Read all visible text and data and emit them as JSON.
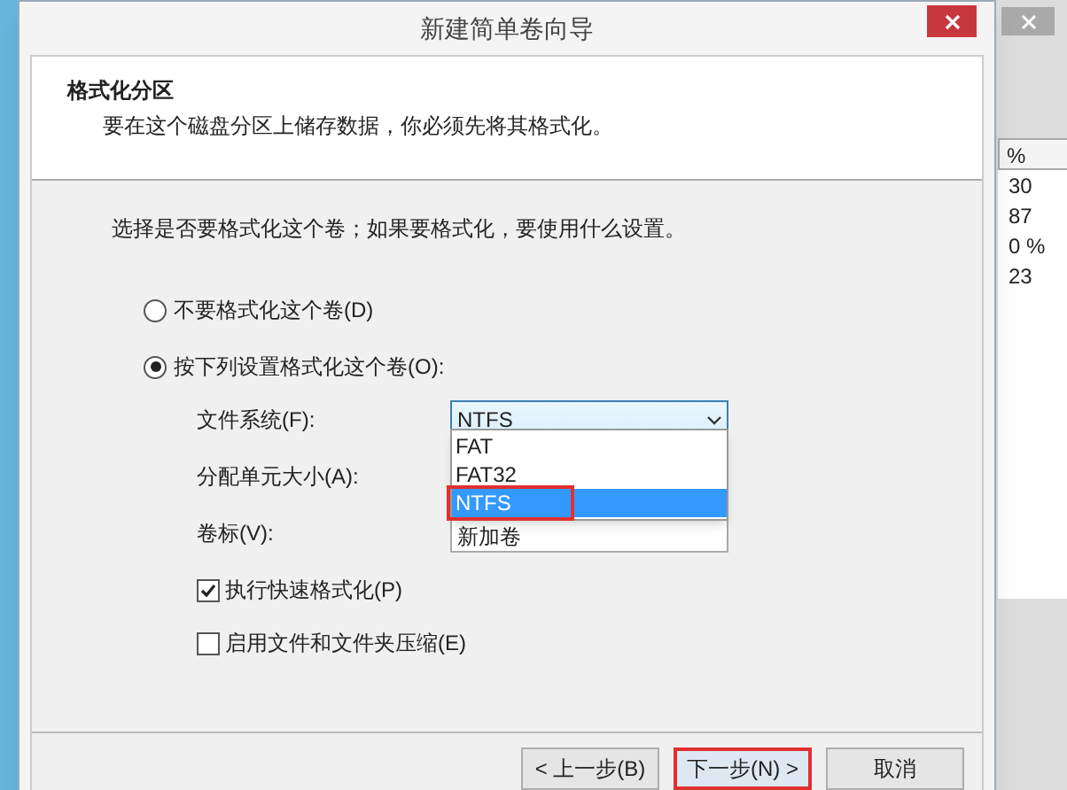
{
  "window": {
    "title": "新建简单卷向导"
  },
  "header": {
    "title": "格式化分区",
    "subtitle": "要在这个磁盘分区上储存数据，你必须先将其格式化。"
  },
  "instruction": "选择是否要格式化这个卷；如果要格式化，要使用什么设置。",
  "options": [
    {
      "label": "不要格式化这个卷(D)",
      "selected": false
    },
    {
      "label": "按下列设置格式化这个卷(O):",
      "selected": true
    }
  ],
  "fields": [
    {
      "label": "文件系统(F):",
      "kind": "combo",
      "value": "NTFS"
    },
    {
      "label": "分配单元大小(A):",
      "kind": "hidden"
    },
    {
      "label": "卷标(V):",
      "kind": "text",
      "value": "新加卷"
    }
  ],
  "dropdown": {
    "items": [
      {
        "label": "FAT",
        "selected": false
      },
      {
        "label": "FAT32",
        "selected": false
      },
      {
        "label": "NTFS",
        "selected": true
      }
    ]
  },
  "checkboxes": [
    {
      "label": "执行快速格式化(P)",
      "checked": true
    },
    {
      "label": "启用文件和文件夹压缩(E)",
      "checked": false
    }
  ],
  "buttons": [
    {
      "label": "< 上一步(B)",
      "highlighted": false
    },
    {
      "label": "下一步(N) >",
      "highlighted": true
    },
    {
      "label": "取消",
      "highlighted": false
    }
  ],
  "background_window": {
    "column_header": "%",
    "values": [
      "30",
      "87",
      "0 %",
      "23"
    ]
  }
}
